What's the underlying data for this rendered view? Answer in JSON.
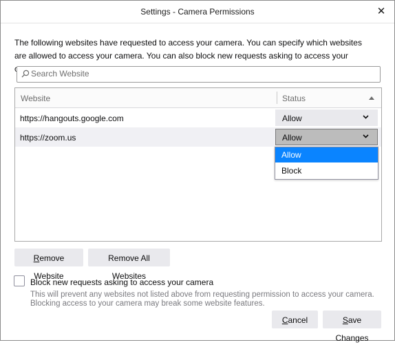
{
  "window": {
    "title": "Settings - Camera Permissions",
    "close_glyph": "✕"
  },
  "description": "The following websites have requested to access your camera. You can specify which websites are allowed to access your camera. You can also block new requests asking to access your camera.",
  "search": {
    "placeholder": "Search Website",
    "value": ""
  },
  "table": {
    "columns": [
      "Website",
      "Status"
    ],
    "sort_indicator": "ascending",
    "rows": [
      {
        "website": "https://hangouts.google.com",
        "status": "Allow"
      },
      {
        "website": "https://zoom.us",
        "status": "Allow"
      }
    ],
    "dropdown_options": [
      "Allow",
      "Block"
    ],
    "dropdown_highlighted": "Allow"
  },
  "buttons": {
    "remove_website_accesskey": "R",
    "remove_website_rest": "emove Website",
    "remove_all": "Remove All Websites",
    "cancel_accesskey": "C",
    "cancel_rest": "ancel",
    "save_accesskey": "S",
    "save_rest": "ave Changes"
  },
  "block_new": {
    "checked": false,
    "label": "Block new requests asking to access your camera",
    "helper": "This will prevent any websites not listed above from requesting permission to access your camera. Blocking access to your camera may break some website features."
  },
  "colors": {
    "accent": "#0a84ff",
    "button_bg": "#e9e9ed",
    "open_select_bg": "#bcbcbc"
  },
  "icons": {
    "search": "search-icon",
    "close": "close-icon",
    "chevron": "chevron-down-icon",
    "sort": "sort-ascending-icon"
  }
}
